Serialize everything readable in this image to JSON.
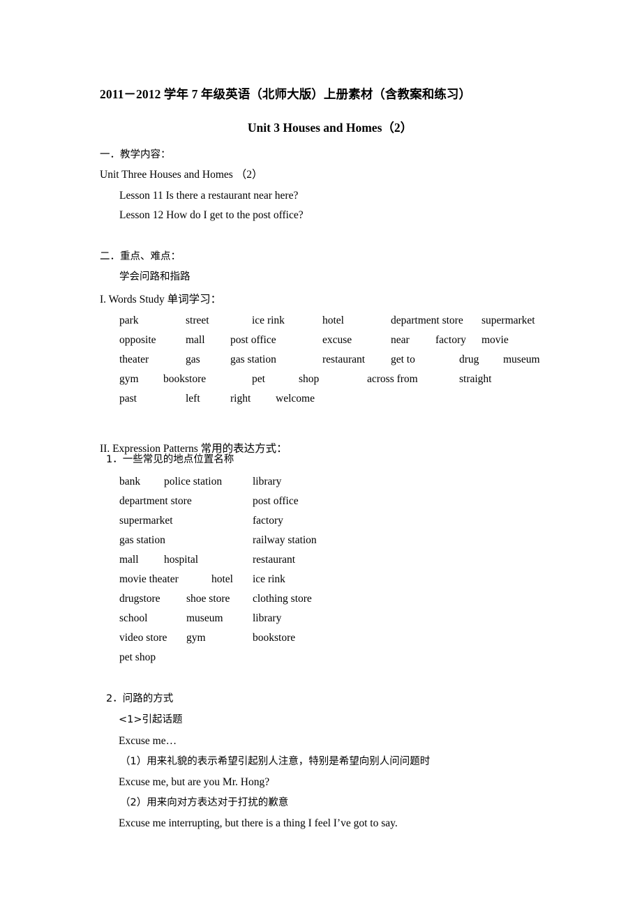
{
  "document": {
    "title": "2011－2012 学年 7 年级英语（北师大版）上册素材（含教案和练习）",
    "unit_title": "Unit 3 Houses and Homes（2）"
  },
  "section_one": {
    "heading": "一．教学内容：",
    "unit_line": "Unit Three Houses and Homes  （2）",
    "lessons": [
      "Lesson 11 Is there a restaurant near here?",
      "Lesson 12 How do I get to the post office?"
    ]
  },
  "section_two": {
    "heading": "二．重点、难点：",
    "subheading": "学会问路和指路",
    "words_study": {
      "heading": "I. Words Study 单词学习：",
      "rows": [
        [
          "park",
          "street",
          "ice rink",
          "hotel",
          "department store",
          "supermarket"
        ],
        [
          "opposite",
          "mall",
          "post office",
          "excuse",
          "near",
          "factory",
          "movie"
        ],
        [
          "theater",
          "gas",
          "gas station",
          "restaurant",
          "get to",
          "drug",
          "museum"
        ],
        [
          "gym",
          "bookstore",
          "pet",
          "shop",
          "across from",
          "straight"
        ],
        [
          "past",
          "left",
          "right",
          "welcome"
        ]
      ]
    },
    "expression_patterns": {
      "heading": "II. Expression Patterns 常用的表达方式：",
      "item1_label": "1．一些常见的地点位置名称",
      "places": [
        [
          "bank",
          "police station",
          "library"
        ],
        [
          "department store",
          "post office"
        ],
        [
          "supermarket",
          "factory"
        ],
        [
          "gas station",
          "railway station"
        ],
        [
          "mall",
          "hospital",
          "restaurant"
        ],
        [
          "movie theater",
          "hotel",
          "ice rink"
        ],
        [
          "drugstore",
          "shoe store",
          "clothing store"
        ],
        [
          "school",
          "museum",
          "library"
        ],
        [
          "video store",
          "gym",
          "bookstore"
        ],
        [
          "pet shop"
        ]
      ],
      "item2_label": "2．问路的方式",
      "sub1_label": "<1>引起话题",
      "excuse_me": "Excuse me…",
      "usage1": "（1）用来礼貌的表示希望引起别人注意，特别是希望向别人问问题时",
      "example1": "Excuse me, but are you Mr. Hong?",
      "usage2": "（2）用来向对方表达对于打扰的歉意",
      "example2": "Excuse me interrupting, but there is a thing I feel I’ve got to say."
    }
  }
}
